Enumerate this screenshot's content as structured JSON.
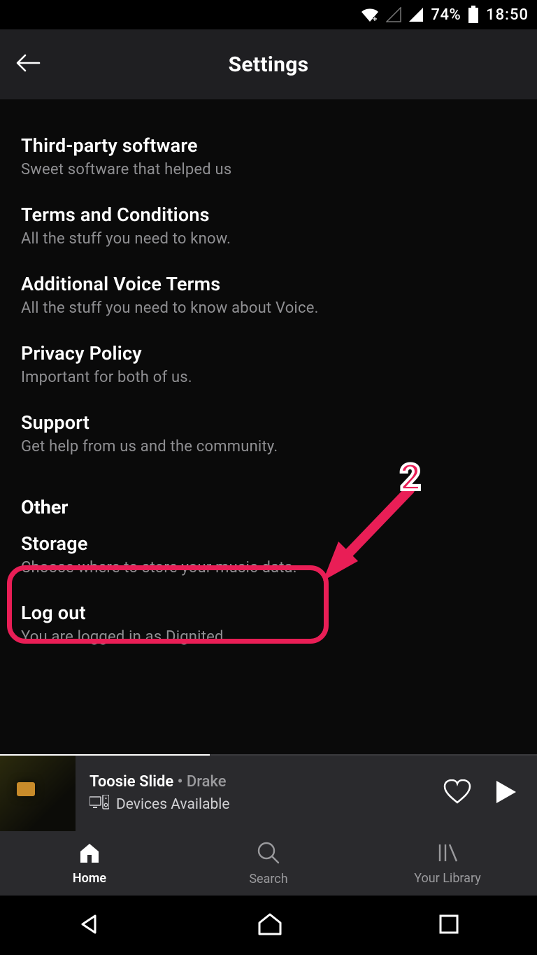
{
  "statusbar": {
    "battery_pct": "74%",
    "time": "18:50"
  },
  "header": {
    "title": "Settings"
  },
  "settings": {
    "items": [
      {
        "title": "Third-party software",
        "sub": "Sweet software that helped us"
      },
      {
        "title": "Terms and Conditions",
        "sub": "All the stuff you need to know."
      },
      {
        "title": "Additional Voice Terms",
        "sub": "All the stuff you need to know about Voice."
      },
      {
        "title": "Privacy Policy",
        "sub": "Important for both of us."
      },
      {
        "title": "Support",
        "sub": "Get help from us and the community."
      }
    ],
    "section_other": "Other",
    "other_items": [
      {
        "title": "Storage",
        "sub": "Choose where to store your music data."
      },
      {
        "title": "Log out",
        "sub": "You are logged in as Dignited"
      }
    ]
  },
  "annotation": {
    "number": "2"
  },
  "nowplaying": {
    "track": "Toosie Slide",
    "separator": "•",
    "artist": "Drake",
    "devices": "Devices Available"
  },
  "tabs": {
    "home": "Home",
    "search": "Search",
    "library": "Your Library"
  }
}
